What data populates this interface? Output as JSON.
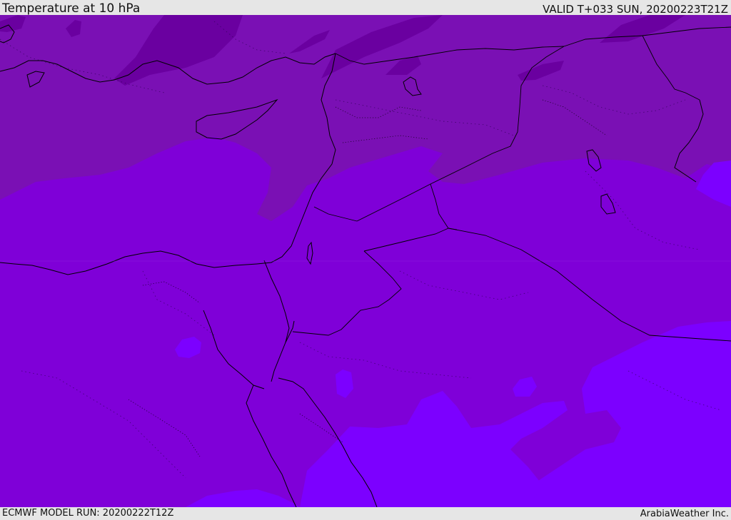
{
  "header": {
    "title": "Temperature at 10 hPa",
    "valid": "VALID T+033 SUN, 20200223T21Z"
  },
  "footer": {
    "model_run": "ECMWF MODEL RUN: 20200222T12Z",
    "credit": "ArabiaWeather Inc."
  },
  "map": {
    "colors": {
      "band_dark": "#6a00a0",
      "band_mid_dark": "#7a10b4",
      "band_mid": "#7f00d8",
      "band_light": "#7c00ff",
      "coastline": "#000000"
    }
  }
}
